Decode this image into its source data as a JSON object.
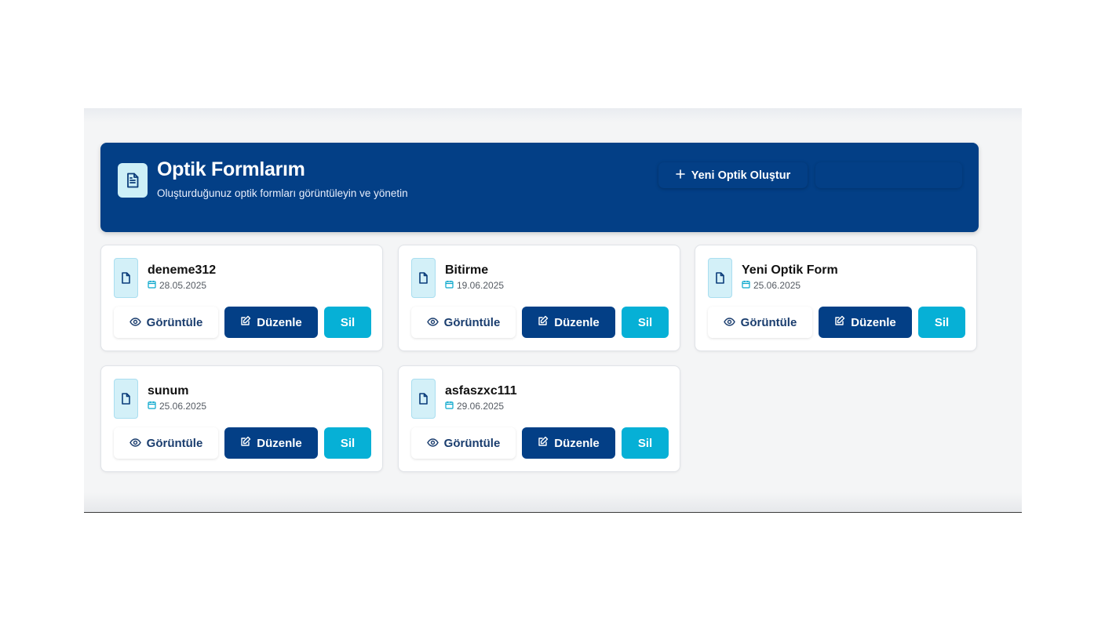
{
  "header": {
    "title": "Optik Formlarım",
    "subtitle": "Oluşturduğunuz optik formları görüntüleyin ve yönetin",
    "icon": "document-icon",
    "new_button_label": "Yeni Optik Oluştur",
    "new_button_icon": "plus-icon"
  },
  "colors": {
    "primary": "#033f86",
    "accent": "#06b0d6",
    "icon_bg": "#d3f0f8"
  },
  "forms": [
    {
      "name": "deneme312",
      "date": "28.05.2025"
    },
    {
      "name": "Bitirme",
      "date": "19.06.2025"
    },
    {
      "name": "Yeni Optik Form",
      "date": "25.06.2025"
    },
    {
      "name": "sunum",
      "date": "25.06.2025"
    },
    {
      "name": "asfaszxc111",
      "date": "29.06.2025"
    }
  ],
  "actions": {
    "view_label": "Görüntüle",
    "edit_label": "Düzenle",
    "delete_label": "Sil",
    "view_icon": "eye-icon",
    "edit_icon": "edit-icon",
    "date_icon": "calendar-icon"
  }
}
